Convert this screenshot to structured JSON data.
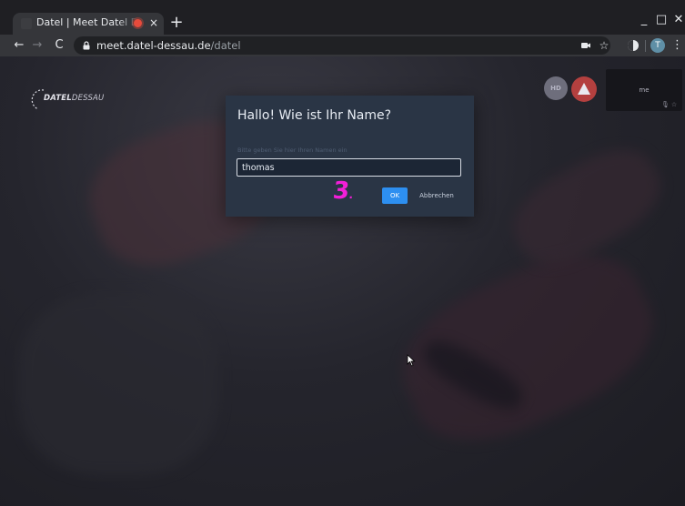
{
  "browser": {
    "tab_title": "Datel | Meet Datel Dessau",
    "tab_close": "×",
    "new_tab": "+",
    "url_host": "meet.datel-dessau.de",
    "url_path": "/datel",
    "profile_initial": "T",
    "window_controls": {
      "minimize": "_",
      "maximize": "□",
      "close": "✕"
    },
    "nav": {
      "back": "←",
      "forward": "→",
      "reload": "C"
    },
    "bookmark_star": "☆",
    "menu": "⋮",
    "recording_color": "#e74b3c"
  },
  "app": {
    "logo_text_bold": "DATEL",
    "logo_text_light": "DESSAU",
    "toolbar": {
      "hd_label": "HD",
      "warning_color": "#b4403f"
    },
    "self_view": {
      "label": "me",
      "icons": "🎙☆"
    }
  },
  "dialog": {
    "title": "Hallo! Wie ist Ihr Name?",
    "field_label": "Bitte geben Sie hier Ihren Namen ein",
    "input_value": "thomas",
    "ok_label": "OK",
    "cancel_label": "Abbrechen",
    "annotation": "3"
  },
  "icons": [
    "lock-icon",
    "camera-icon",
    "star-icon",
    "extension-icon",
    "warning-icon",
    "mic-icon",
    "cursor-icon"
  ]
}
